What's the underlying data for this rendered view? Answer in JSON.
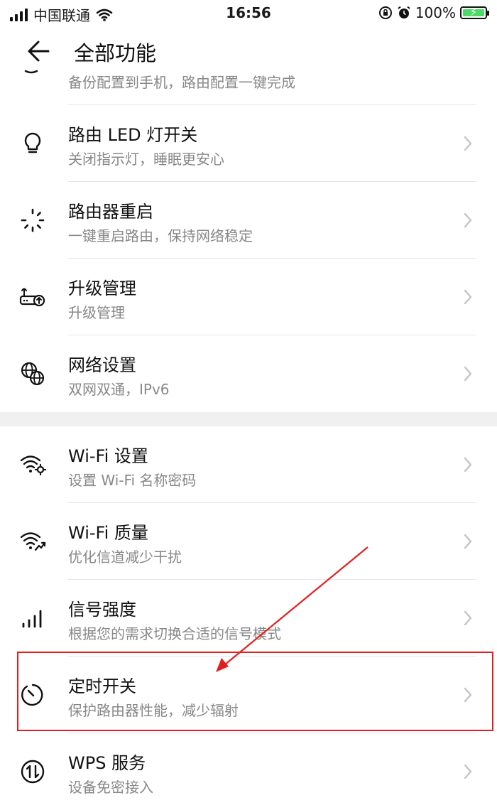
{
  "status_bar": {
    "carrier": "中国联通",
    "time": "16:56",
    "battery": "100%",
    "status_icons": [
      "signal-icon",
      "wifi-icon",
      "rotation-lock-icon",
      "alarm-icon",
      "battery-charging-icon"
    ]
  },
  "header": {
    "title": "全部功能",
    "back_icon": "arrow-left-icon"
  },
  "partial_item": {
    "subtitle": "备份配置到手机，路由配置一键完成",
    "icon": "backup-icon"
  },
  "section1": [
    {
      "title": "路由 LED 灯开关",
      "subtitle": "关闭指示灯，睡眠更安心",
      "icon": "bulb-icon"
    },
    {
      "title": "路由器重启",
      "subtitle": "一键重启路由，保持网络稳定",
      "icon": "restart-spinner-icon"
    },
    {
      "title": "升级管理",
      "subtitle": "升级管理",
      "icon": "router-upgrade-icon"
    },
    {
      "title": "网络设置",
      "subtitle": "双网双通，IPv6",
      "icon": "globe-icon"
    }
  ],
  "section2": [
    {
      "title": "Wi-Fi 设置",
      "subtitle": "设置 Wi-Fi 名称密码",
      "icon": "wifi-settings-icon"
    },
    {
      "title": "Wi-Fi 质量",
      "subtitle": "优化信道减少干扰",
      "icon": "wifi-quality-icon"
    },
    {
      "title": "信号强度",
      "subtitle": "根据您的需求切换合适的信号模式",
      "icon": "signal-strength-icon"
    },
    {
      "title": "定时开关",
      "subtitle": "保护路由器性能，减少辐射",
      "icon": "timer-icon"
    },
    {
      "title": "WPS 服务",
      "subtitle": "设备免密接入",
      "icon": "wps-icon"
    }
  ],
  "annotation": {
    "color": "#e02020",
    "highlighted_item": "定时开关"
  }
}
